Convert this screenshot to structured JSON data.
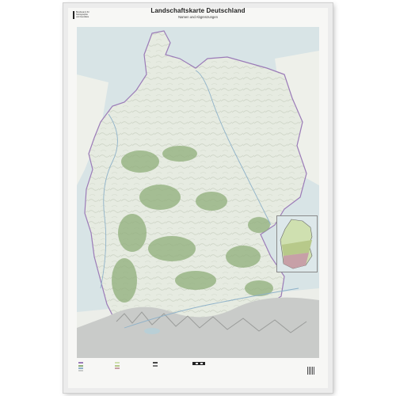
{
  "poster": {
    "title": "Landschaftskarte Deutschland",
    "subtitle": "Namen und Abgrenzungen",
    "publisher_logo_text": "Bundesamt für\nKartographie\nund Geodäsie"
  },
  "map": {
    "country": "Deutschland",
    "inset_present": true,
    "colors": {
      "sea": "#d8e4e6",
      "lowland": "#e7ece3",
      "forest": "#8fae7a",
      "alps_rock": "#c9cbc9",
      "border": "#9b7bb8",
      "inset_north": "#cfe0b0",
      "inset_middle": "#b7c98a",
      "inset_south": "#c7a0a7"
    }
  },
  "legend": {
    "columns": 4
  }
}
